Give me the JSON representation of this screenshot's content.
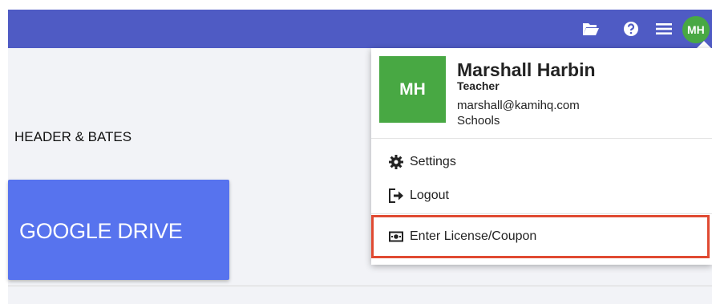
{
  "topbar": {
    "icons": [
      "folder-open-icon",
      "help-icon",
      "menu-icon"
    ],
    "avatar_initials": "MH",
    "color": "#4f5bc4"
  },
  "content": {
    "header_bates": "HEADER & BATES",
    "gdrive_label": "GOOGLE DRIVE",
    "gdrive_color": "#5773ee"
  },
  "user_menu": {
    "avatar_initials": "MH",
    "avatar_color": "#48a843",
    "name": "Marshall Harbin",
    "role": "Teacher",
    "email": "marshall@kamihq.com",
    "org": "Schools",
    "items": [
      {
        "label": "Settings",
        "icon": "gear-icon"
      },
      {
        "label": "Logout",
        "icon": "logout-icon"
      },
      {
        "label": "Enter License/Coupon",
        "icon": "license-card-icon"
      }
    ],
    "highlight_color": "#e04a32"
  }
}
